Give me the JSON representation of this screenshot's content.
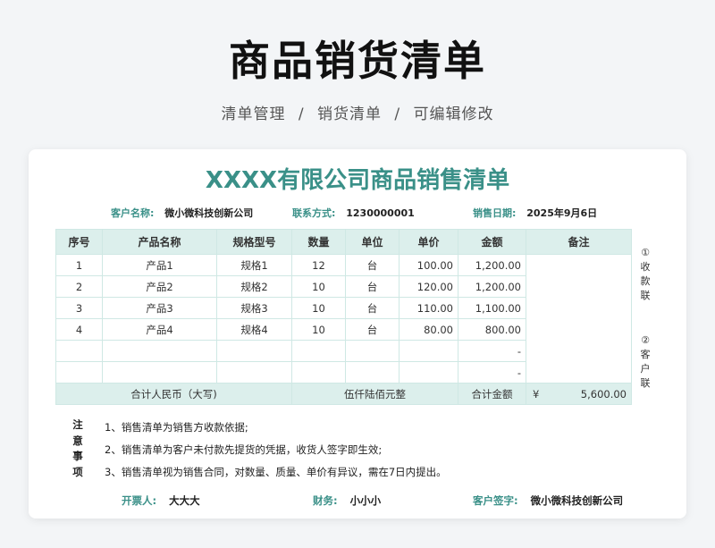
{
  "header": {
    "title": "商品销货清单",
    "breadcrumb": [
      "清单管理",
      "销货清单",
      "可编辑修改"
    ],
    "separator": "/"
  },
  "document": {
    "title": "XXXX有限公司商品销售清单",
    "customer": {
      "label": "客户名称:",
      "value": "微小微科技创新公司"
    },
    "contact": {
      "label": "联系方式:",
      "value": "1230000001"
    },
    "date": {
      "label": "销售日期:",
      "value": "2025年9月6日"
    },
    "columns": [
      "序号",
      "产品名称",
      "规格型号",
      "数量",
      "单位",
      "单价",
      "金额",
      "备注"
    ],
    "rows": [
      {
        "no": "1",
        "name": "产品1",
        "spec": "规格1",
        "qty": "12",
        "unit": "台",
        "price": "100.00",
        "amount": "1,200.00"
      },
      {
        "no": "2",
        "name": "产品2",
        "spec": "规格2",
        "qty": "10",
        "unit": "台",
        "price": "120.00",
        "amount": "1,200.00"
      },
      {
        "no": "3",
        "name": "产品3",
        "spec": "规格3",
        "qty": "10",
        "unit": "台",
        "price": "110.00",
        "amount": "1,100.00"
      },
      {
        "no": "4",
        "name": "产品4",
        "spec": "规格4",
        "qty": "10",
        "unit": "台",
        "price": "80.00",
        "amount": "800.00"
      },
      {
        "no": "",
        "name": "",
        "spec": "",
        "qty": "",
        "unit": "",
        "price": "",
        "amount": "-"
      },
      {
        "no": "",
        "name": "",
        "spec": "",
        "qty": "",
        "unit": "",
        "price": "",
        "amount": "-"
      }
    ],
    "total": {
      "label_cn": "合计人民币（大写)",
      "value_cn": "伍仟陆佰元整",
      "label_amount": "合计金额",
      "currency": "¥",
      "value": "5,600.00"
    },
    "side_labels": [
      [
        "①",
        "收",
        "款",
        "联"
      ],
      [
        "②",
        "客",
        "户",
        "联"
      ]
    ],
    "notes_title": [
      "注",
      "意",
      "事",
      "项"
    ],
    "notes": [
      "1、销售清单为销售方收款依据;",
      "2、销售清单为客户未付款先提货的凭据，收货人签字即生效;",
      "3、销售清单视为销售合同，对数量、质量、单价有异议，需在7日内提出。"
    ],
    "signatures": {
      "issuer": {
        "label": "开票人:",
        "value": "大大大"
      },
      "finance": {
        "label": "财务:",
        "value": "小小小"
      },
      "customer": {
        "label": "客户签字:",
        "value": "微小微科技创新公司"
      }
    }
  }
}
